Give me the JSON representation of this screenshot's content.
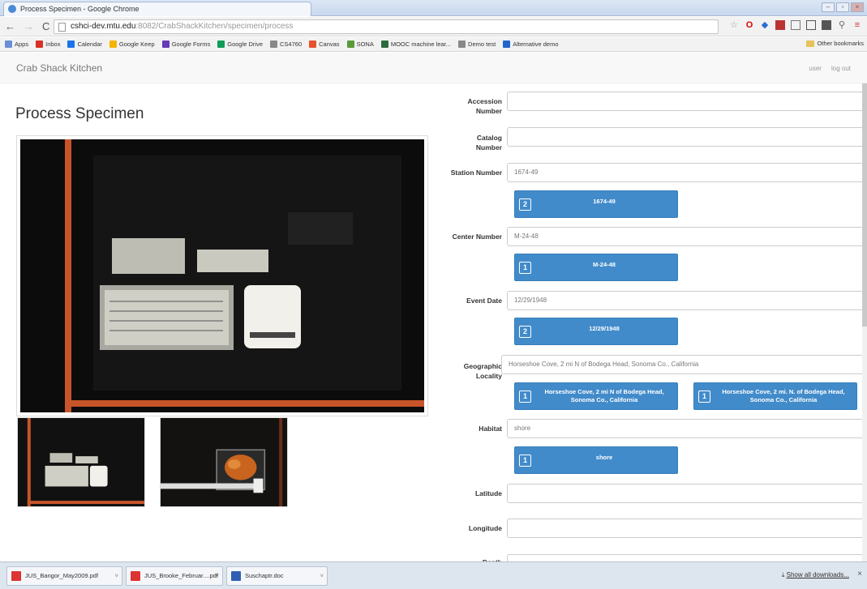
{
  "browser": {
    "tab_title": "Process Specimen - Google Chrome",
    "url_host": "cshci-dev.mtu.edu",
    "url_path": ":8082/CrabShackKitchen/specimen/process",
    "bookmarks": [
      {
        "label": "Apps",
        "color": "#6a8fd6"
      },
      {
        "label": "Inbox",
        "color": "#d93025"
      },
      {
        "label": "Calendar",
        "color": "#1a73e8"
      },
      {
        "label": "Google Keep",
        "color": "#f4b400"
      },
      {
        "label": "Google Forms",
        "color": "#673ab7"
      },
      {
        "label": "Google Drive",
        "color": "#0f9d58"
      },
      {
        "label": "CS4760",
        "color": "#888888"
      },
      {
        "label": "Canvas",
        "color": "#e5532d"
      },
      {
        "label": "SONA",
        "color": "#5a9a3a"
      },
      {
        "label": "MOOC machine lear...",
        "color": "#2d6a3e"
      },
      {
        "label": "Demo test",
        "color": "#888888"
      },
      {
        "label": "Alternative demo",
        "color": "#2266cc"
      }
    ],
    "other_bookmarks": "Other bookmarks"
  },
  "app": {
    "brand": "Crab Shack Kitchen",
    "user_link": "user",
    "logout_link": "log out",
    "page_title": "Process Specimen"
  },
  "form": {
    "accession": {
      "label_1": "Accession",
      "label_2": "Number",
      "value": ""
    },
    "catalog": {
      "label_1": "Catalog",
      "label_2": "Number",
      "value": ""
    },
    "station": {
      "label": "Station Number",
      "value": "1674-49",
      "suggestions": [
        {
          "count": "2",
          "text": "1674-49"
        }
      ]
    },
    "center": {
      "label": "Center Number",
      "value": "M-24-48",
      "suggestions": [
        {
          "count": "1",
          "text": "M-24-48"
        }
      ]
    },
    "event_date": {
      "label": "Event Date",
      "value": "12/29/1948",
      "suggestions": [
        {
          "count": "2",
          "text": "12/29/1948"
        }
      ]
    },
    "locality": {
      "label_1": "Geographic",
      "label_2": "Locality",
      "value": "Horseshoe Cove, 2 mi N of Bodega Head, Sonoma Co., California",
      "suggestions": [
        {
          "count": "1",
          "text": "Horseshoe Cove, 2 mi N of Bodega Head, Sonoma Co., California"
        },
        {
          "count": "1",
          "text": "Horseshoe Cove, 2 mi. N. of Bodega Head, Sonoma Co., California"
        }
      ]
    },
    "habitat": {
      "label": "Habitat",
      "value": "shore",
      "suggestions": [
        {
          "count": "1",
          "text": "shore"
        }
      ]
    },
    "latitude": {
      "label": "Latitude",
      "value": ""
    },
    "longitude": {
      "label": "Longitude",
      "value": ""
    },
    "depth": {
      "label": "Depth",
      "value": ""
    }
  },
  "downloads": {
    "items": [
      {
        "name": "JUS_Bangor_May2009.pdf",
        "type": "pdf"
      },
      {
        "name": "JUS_Brooke_Februar....pdf",
        "type": "pdf"
      },
      {
        "name": "Suschaptr.doc",
        "type": "doc"
      }
    ],
    "show_all": "Show all downloads..."
  },
  "colors": {
    "suggestion_blue": "#428bca",
    "frame_orange": "#c8552a"
  }
}
